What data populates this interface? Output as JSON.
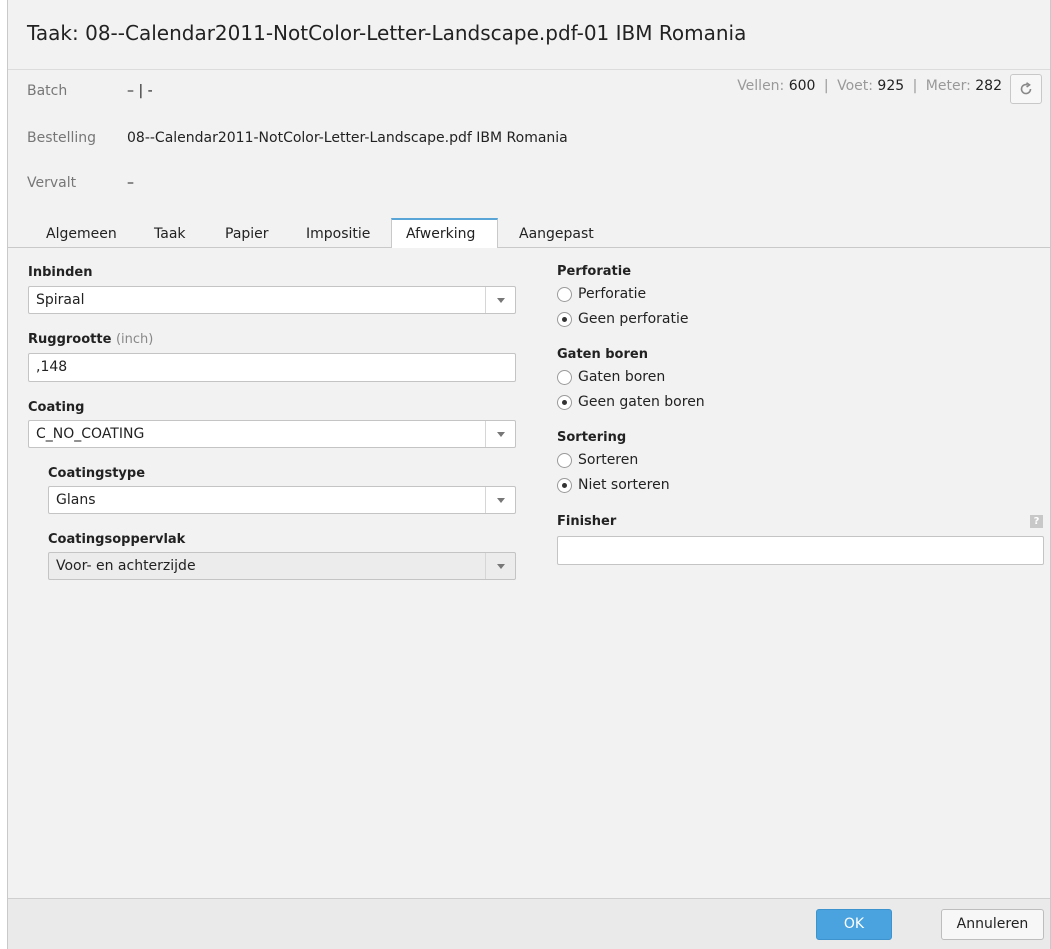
{
  "title": {
    "prefix": "Taak:",
    "name": "08--Calendar2011-NotColor-Letter-Landscape.pdf-01 IBM Romania"
  },
  "info": {
    "batch_label": "Batch",
    "batch_value": "– | -",
    "order_label": "Bestelling",
    "order_value": "08--Calendar2011-NotColor-Letter-Landscape.pdf IBM Romania",
    "due_label": "Vervalt",
    "due_value": "–",
    "counters": {
      "sheets_label": "Vellen:",
      "sheets_value": "600",
      "feet_label": "Voet:",
      "feet_value": "925",
      "meter_label": "Meter:",
      "meter_value": "282",
      "separator": "|"
    },
    "refresh_icon": "refresh-icon"
  },
  "tabs": [
    {
      "label": "Algemeen"
    },
    {
      "label": "Taak"
    },
    {
      "label": "Papier"
    },
    {
      "label": "Impositie"
    },
    {
      "label": "Afwerking"
    },
    {
      "label": "Aangepast"
    }
  ],
  "finishing": {
    "binding": {
      "label": "Inbinden",
      "value": "Spiraal"
    },
    "spine": {
      "label": "Ruggrootte",
      "unit": "(inch)",
      "value": ",148"
    },
    "coating": {
      "label": "Coating",
      "value": "C_NO_COATING"
    },
    "coating_type": {
      "label": "Coatingstype",
      "value": "Glans"
    },
    "coating_surface": {
      "label": "Coatingsoppervlak",
      "value": "Voor- en achterzijde"
    },
    "perforation": {
      "label": "Perforatie",
      "option_yes": "Perforatie",
      "option_no": "Geen perforatie",
      "selected": "Geen perforatie"
    },
    "drilling": {
      "label": "Gaten boren",
      "option_yes": "Gaten boren",
      "option_no": "Geen gaten boren",
      "selected": "Geen gaten boren"
    },
    "sorting": {
      "label": "Sortering",
      "option_yes": "Sorteren",
      "option_no": "Niet sorteren",
      "selected": "Niet sorteren"
    },
    "finisher": {
      "label": "Finisher",
      "value": "",
      "help": "?"
    }
  },
  "footer": {
    "ok_label": "OK",
    "cancel_label": "Annuleren"
  },
  "colors": {
    "accent": "#4aa3df",
    "tab_highlight": "#5aa5d8",
    "background": "#f2f2f2"
  }
}
